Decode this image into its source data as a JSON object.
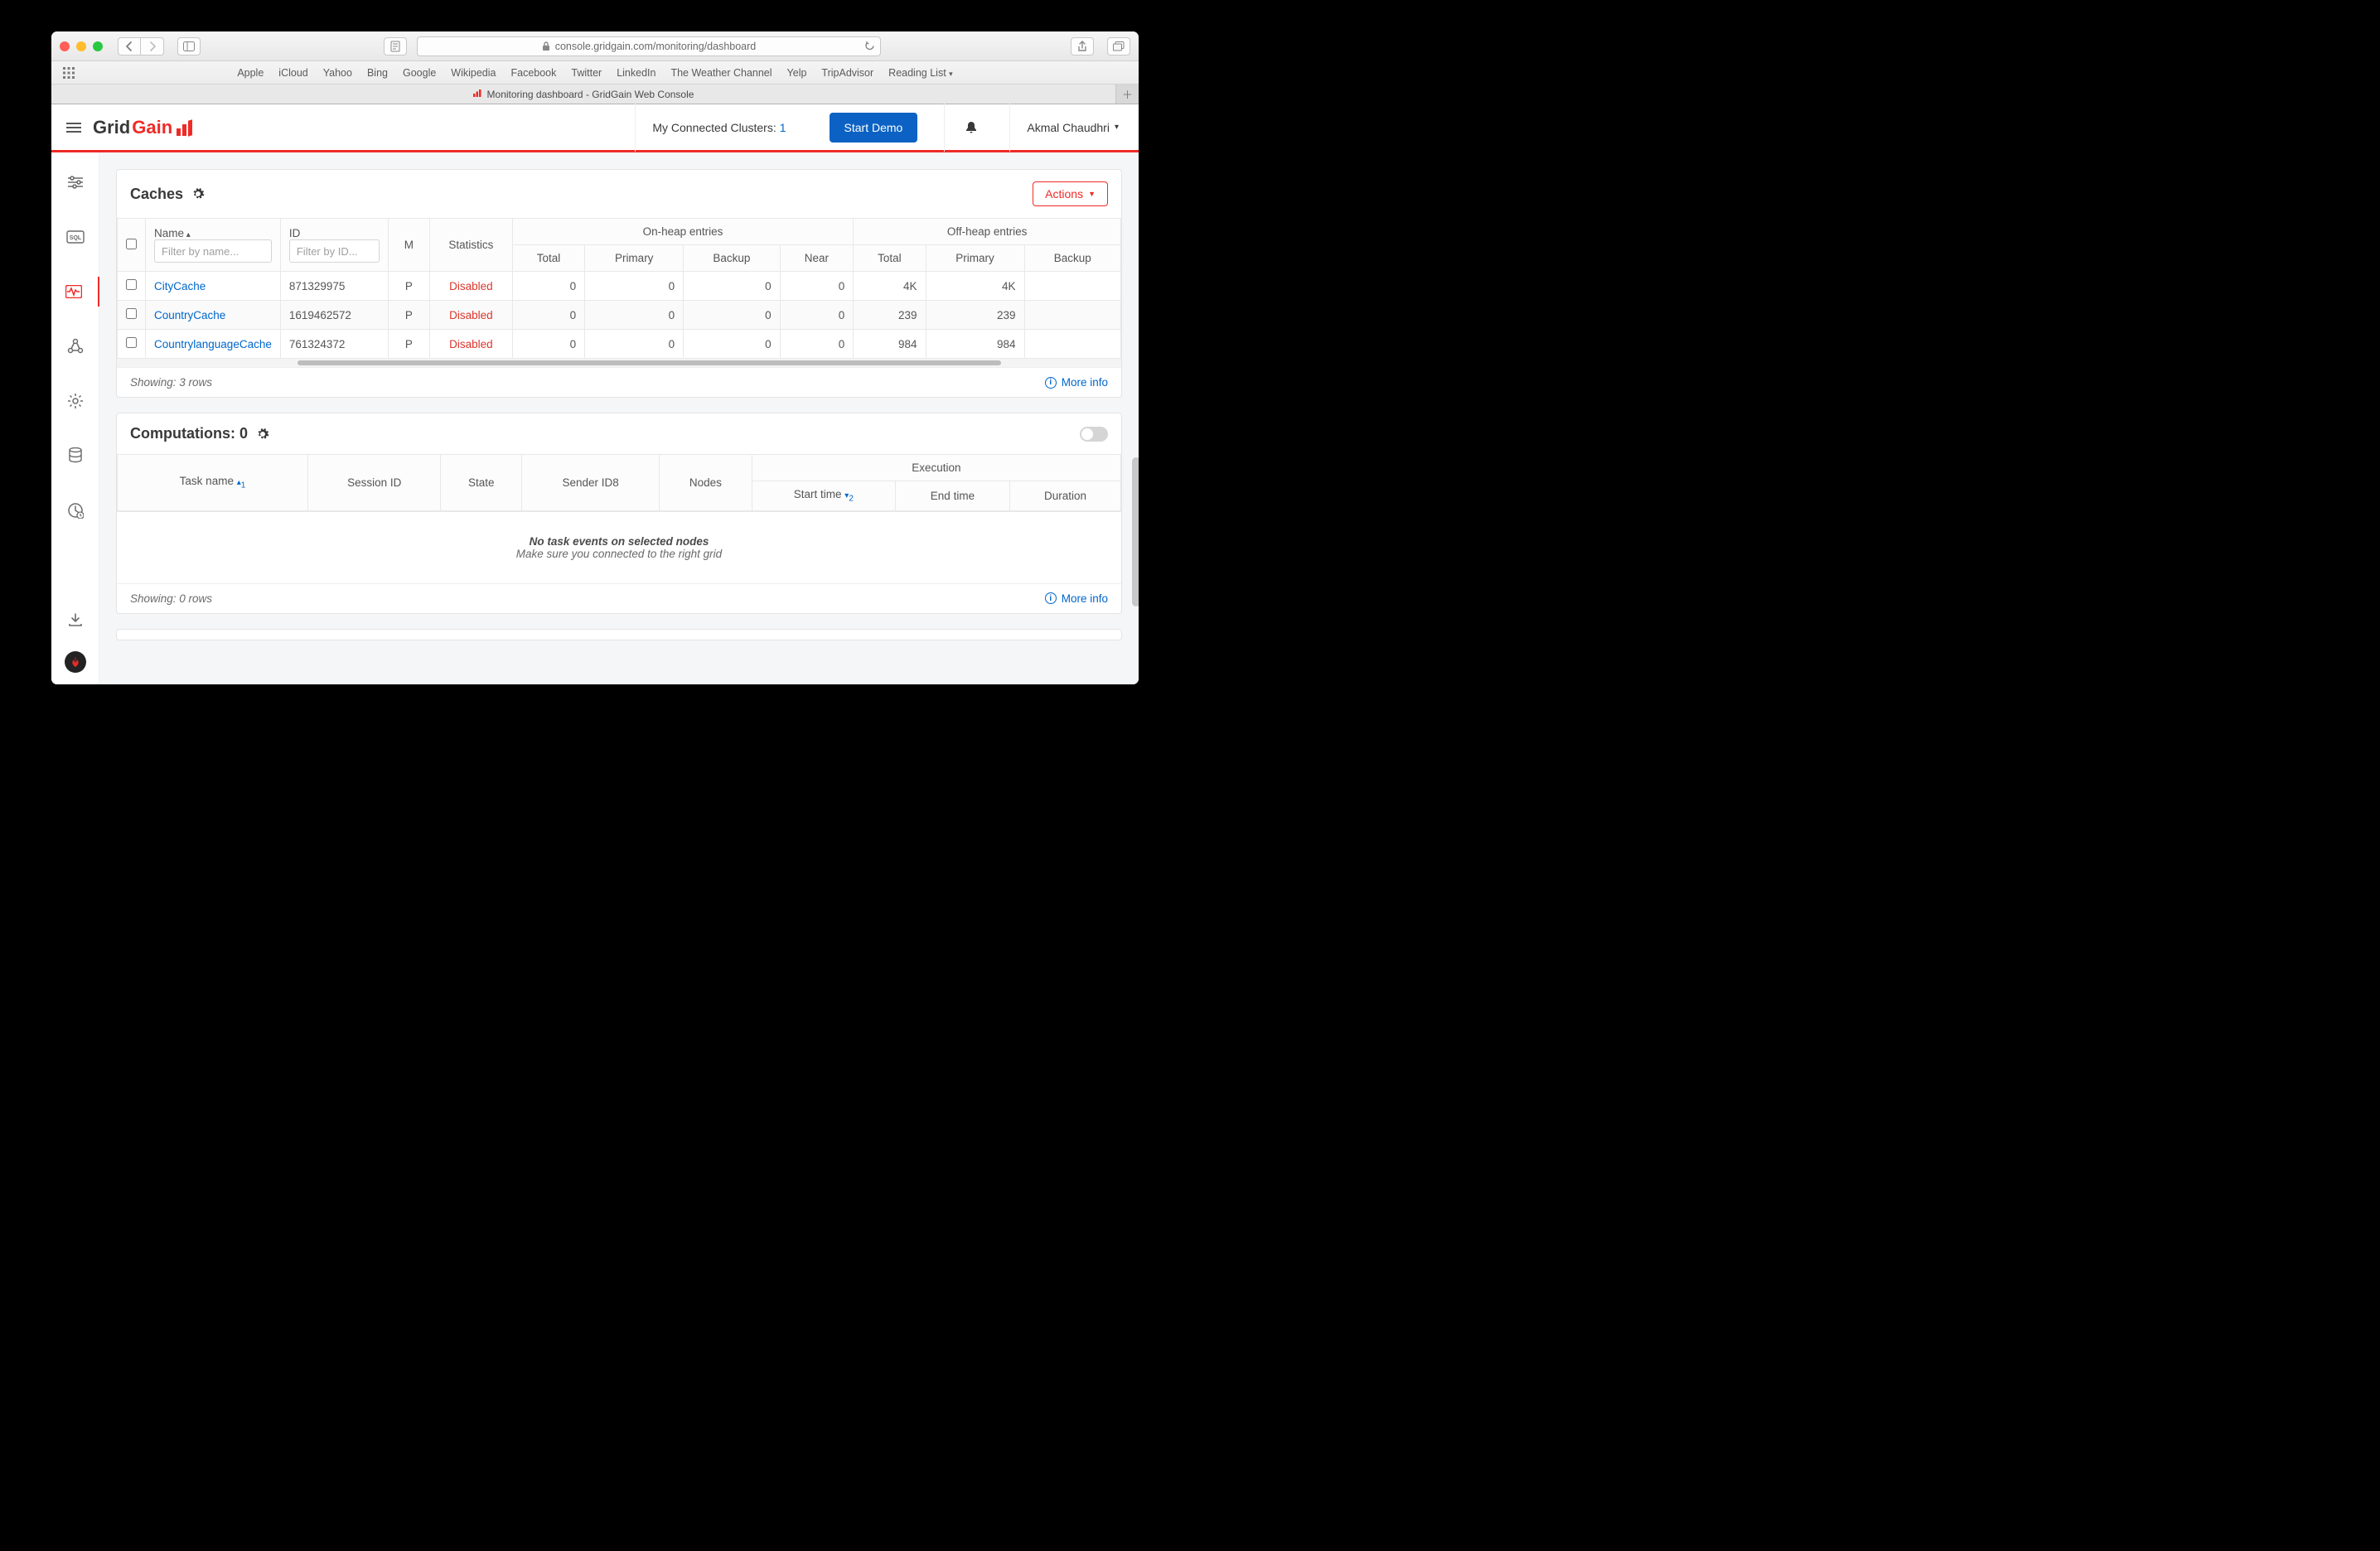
{
  "browser": {
    "url_display": "console.gridgain.com/monitoring/dashboard",
    "bookmarks": [
      "Apple",
      "iCloud",
      "Yahoo",
      "Bing",
      "Google",
      "Wikipedia",
      "Facebook",
      "Twitter",
      "LinkedIn",
      "The Weather Channel",
      "Yelp",
      "TripAdvisor",
      "Reading List"
    ],
    "tab_title": "Monitoring dashboard - GridGain Web Console"
  },
  "header": {
    "clusters_label": "My Connected Clusters:",
    "clusters_count": "1",
    "start_demo": "Start Demo",
    "user_name": "Akmal Chaudhri"
  },
  "caches": {
    "title": "Caches",
    "actions_label": "Actions",
    "columns": {
      "name": "Name",
      "id": "ID",
      "m": "M",
      "statistics": "Statistics",
      "onheap": "On-heap entries",
      "offheap": "Off-heap entries",
      "total": "Total",
      "primary": "Primary",
      "backup": "Backup",
      "near": "Near"
    },
    "filters": {
      "name_placeholder": "Filter by name...",
      "id_placeholder": "Filter by ID..."
    },
    "rows": [
      {
        "name": "CityCache",
        "id": "871329975",
        "m": "P",
        "statistics": "Disabled",
        "oh_total": "0",
        "oh_primary": "0",
        "oh_backup": "0",
        "oh_near": "0",
        "off_total": "4K",
        "off_primary": "4K",
        "off_backup": ""
      },
      {
        "name": "CountryCache",
        "id": "1619462572",
        "m": "P",
        "statistics": "Disabled",
        "oh_total": "0",
        "oh_primary": "0",
        "oh_backup": "0",
        "oh_near": "0",
        "off_total": "239",
        "off_primary": "239",
        "off_backup": ""
      },
      {
        "name": "CountrylanguageCache",
        "id": "761324372",
        "m": "P",
        "statistics": "Disabled",
        "oh_total": "0",
        "oh_primary": "0",
        "oh_backup": "0",
        "oh_near": "0",
        "off_total": "984",
        "off_primary": "984",
        "off_backup": ""
      }
    ],
    "showing": "Showing: 3 rows",
    "more_info": "More info"
  },
  "computations": {
    "title": "Computations: 0",
    "columns": {
      "task_name": "Task name",
      "session_id": "Session ID",
      "state": "State",
      "sender": "Sender ID8",
      "nodes": "Nodes",
      "execution": "Execution",
      "start": "Start time",
      "end": "End time",
      "duration": "Duration"
    },
    "empty_bold": "No task events on selected nodes",
    "empty_sub": "Make sure you connected to the right grid",
    "showing": "Showing: 0 rows",
    "more_info": "More info"
  }
}
